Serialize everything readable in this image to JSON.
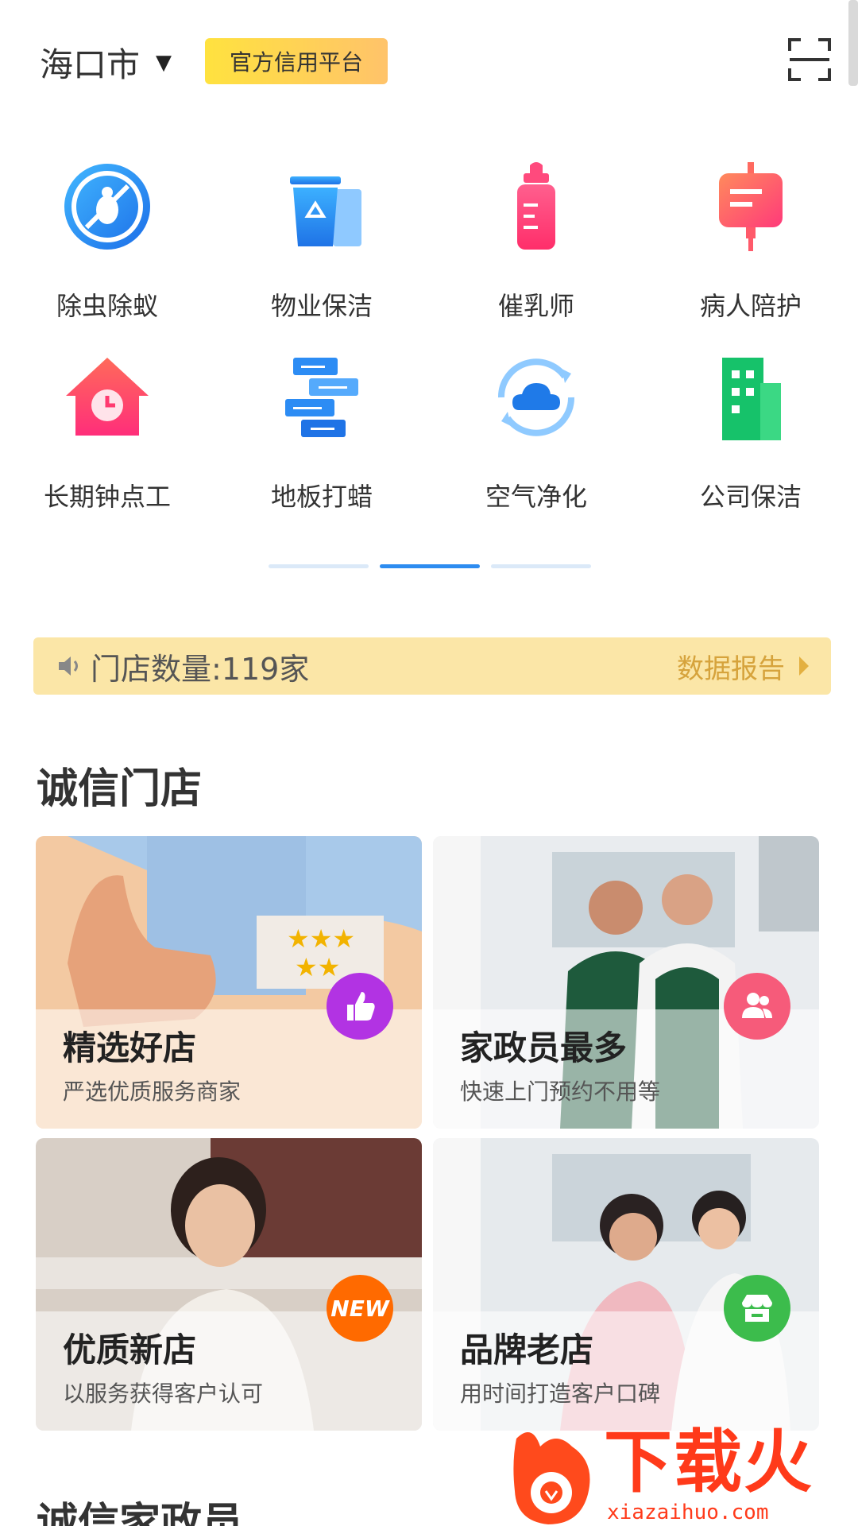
{
  "header": {
    "city": "海口市",
    "badge": "官方信用平台"
  },
  "categories": [
    {
      "label": "除虫除蚁",
      "icon": "bug-shield-icon"
    },
    {
      "label": "物业保洁",
      "icon": "trash-bin-icon"
    },
    {
      "label": "催乳师",
      "icon": "baby-bottle-icon"
    },
    {
      "label": "病人陪护",
      "icon": "iv-bag-icon"
    },
    {
      "label": "长期钟点工",
      "icon": "house-clock-icon"
    },
    {
      "label": "地板打蜡",
      "icon": "floor-boards-icon"
    },
    {
      "label": "空气净化",
      "icon": "cloud-refresh-icon"
    },
    {
      "label": "公司保洁",
      "icon": "building-icon"
    }
  ],
  "notice": {
    "text": "门店数量:119家",
    "link": "数据报告"
  },
  "section1": {
    "title": "诚信门店"
  },
  "cards": [
    {
      "title": "精选好店",
      "subtitle": "严选优质服务商家",
      "badge": "thumbs-up-icon",
      "badge_color": "#b233e3"
    },
    {
      "title": "家政员最多",
      "subtitle": "快速上门预约不用等",
      "badge": "people-icon",
      "badge_color": "#f65b7a"
    },
    {
      "title": "优质新店",
      "subtitle": "以服务获得客户认可",
      "badge": "NEW",
      "badge_color": "#ff6a00"
    },
    {
      "title": "品牌老店",
      "subtitle": "用时间打造客户口碑",
      "badge": "shop-icon",
      "badge_color": "#3cbc4c"
    }
  ],
  "section2": {
    "title": "诚信家政员"
  },
  "watermark": {
    "main": "下载火",
    "url": "xiazaihuo.com"
  }
}
